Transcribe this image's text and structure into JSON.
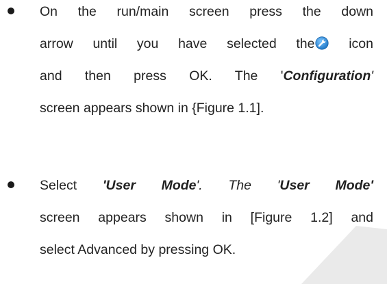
{
  "items": [
    {
      "lines": [
        {
          "text": "On the run/main screen press the down"
        },
        {
          "before": "arrow until you have selected the",
          "icon": "wrench-settings-icon",
          "after": " icon"
        },
        {
          "before": "and then press OK. The '",
          "emph": "Configuration",
          "after": "'"
        },
        {
          "text": "screen appears shown in {Figure 1.1]."
        }
      ]
    },
    {
      "lines": [
        {
          "before": "Select ",
          "emph_open": "'User Mode",
          "middle": "'. The '",
          "emph": "User Mode'",
          "after": ""
        },
        {
          "text": "screen appears shown in [Figure 1.2] and"
        },
        {
          "text": "select Advanced by pressing OK."
        }
      ]
    }
  ],
  "colors": {
    "text": "#222222",
    "icon": "#2a8fd8",
    "watermark": "#e6e6e6"
  }
}
